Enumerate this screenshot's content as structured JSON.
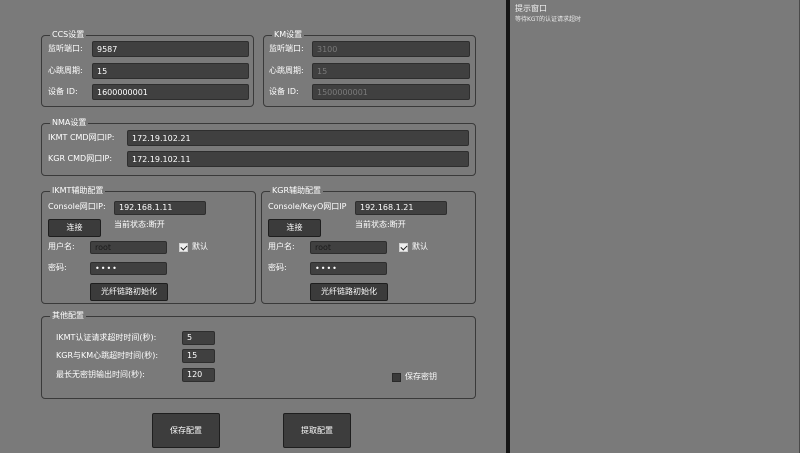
{
  "ccs": {
    "title": "CCS设置",
    "listen_port_label": "监听端口:",
    "listen_port_value": "9587",
    "heartbeat_label": "心跳周期:",
    "heartbeat_value": "15",
    "device_id_label": "设备 ID:",
    "device_id_value": "1600000001"
  },
  "km": {
    "title": "KM设置",
    "listen_port_label": "监听端口:",
    "listen_port_value": "3100",
    "heartbeat_label": "心跳周期:",
    "heartbeat_value": "15",
    "device_id_label": "设备 ID:",
    "device_id_value": "1500000001"
  },
  "nma": {
    "title": "NMA设置",
    "ikmt_label": "IKMT CMD网口IP:",
    "ikmt_value": "172.19.102.21",
    "kgr_label": "KGR CMD网口IP:",
    "kgr_value": "172.19.102.11"
  },
  "ikmt_aux": {
    "title": "IKMT辅助配置",
    "console_label": "Console网口IP:",
    "console_value": "192.168.1.11",
    "connect_label": "连接",
    "state_text": "当前状态:断开",
    "username_label": "用户名:",
    "username_value": "root",
    "default_label": "默认",
    "default_checked": true,
    "password_label": "密码:",
    "password_value": "••••",
    "init_label": "光纤链路初始化"
  },
  "kgr_aux": {
    "title": "KGR辅助配置",
    "console_label": "Console/KeyO网口IP",
    "console_value": "192.168.1.21",
    "connect_label": "连接",
    "state_text": "当前状态:断开",
    "username_label": "用户名:",
    "username_value": "root",
    "default_label": "默认",
    "default_checked": true,
    "password_label": "密码:",
    "password_value": "••••",
    "init_label": "光纤链路初始化"
  },
  "other": {
    "title": "其他配置",
    "auth_timeout_label": "IKMT认证请求超时时间(秒):",
    "auth_timeout_value": "5",
    "hb_timeout_label": "KGR与KM心跳超时时间(秒):",
    "hb_timeout_value": "15",
    "key_output_label": "最长无密钥输出时间(秒):",
    "key_output_value": "120",
    "save_key_label": "保存密钥",
    "save_key_checked": false
  },
  "actions": {
    "save_label": "保存配置",
    "read_label": "提取配置"
  },
  "hint": {
    "title": "提示窗口",
    "message": "等待KGT的认证请求超时"
  }
}
